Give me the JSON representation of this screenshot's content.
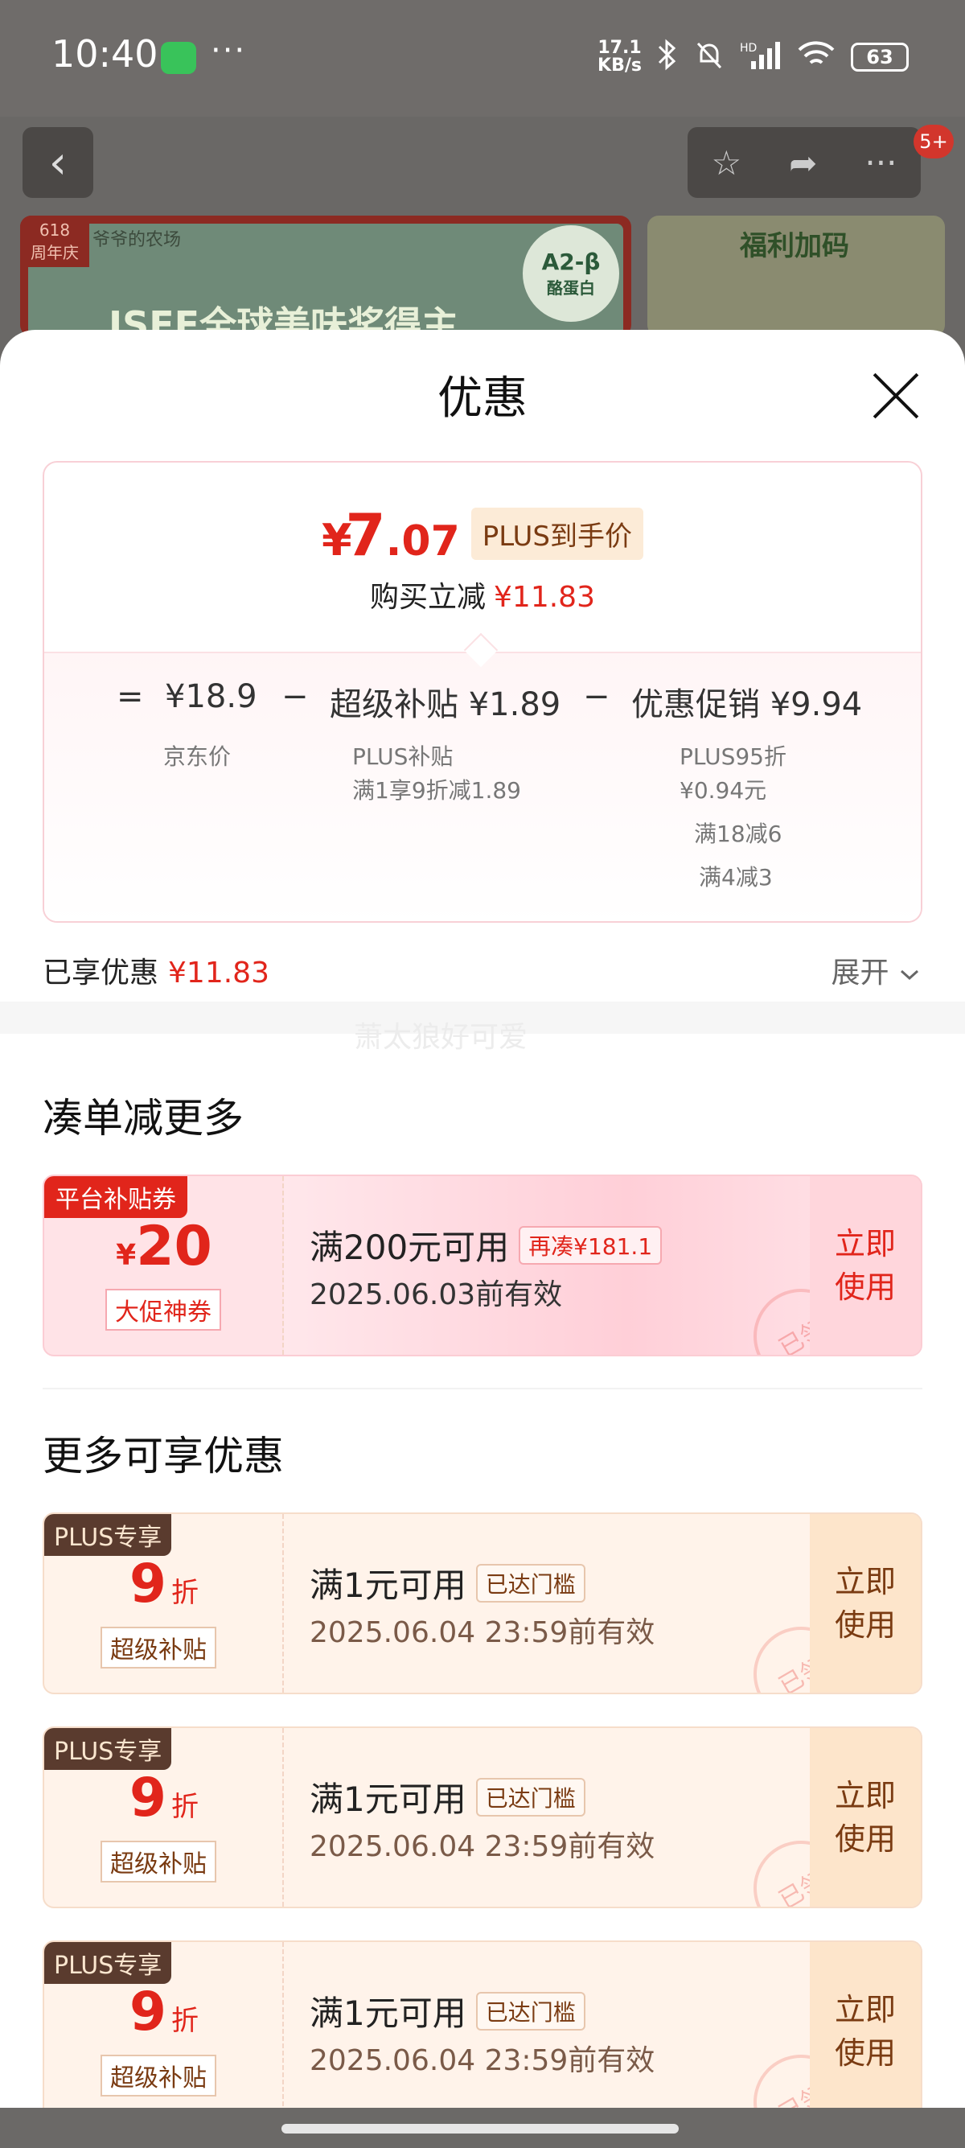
{
  "status_bar": {
    "time": "10:40",
    "dots": "···",
    "net_speed_value": "17.1",
    "net_speed_unit": "KB/s",
    "signal_label": "HD",
    "battery": "63"
  },
  "product_header": {
    "badge": "5+",
    "banner": {
      "tag_top": "618",
      "tag_bottom": "周年庆",
      "brand": "爷爷的农场",
      "slogan": "ISEE全球美味奖得主",
      "seal_title": "A2-β",
      "seal_sub": "酪蛋白"
    },
    "promo_title": "福利加码"
  },
  "sheet": {
    "title": "优惠",
    "price": {
      "currency": "¥",
      "integer": "7",
      "decimal": ".07",
      "plus_label": "PLUS到手价",
      "discount_label": "购买立减",
      "discount_value": "¥11.83",
      "formula": {
        "eq": "=",
        "jd_price": "¥18.9",
        "minus1": "−",
        "subsidy": "超级补贴 ¥1.89",
        "minus2": "−",
        "promo": "优惠促销 ¥9.94",
        "jd_price_label": "京东价",
        "subsidy_lines": [
          "PLUS补贴",
          "满1享9折减1.89"
        ],
        "promo_lines": [
          "PLUS95折",
          "¥0.94元",
          "满18减6",
          "满4减3"
        ]
      }
    },
    "enjoyed_label": "已享优惠",
    "enjoyed_value": "¥11.83",
    "expand_label": "展开",
    "watermark": "萧太狼好可爱",
    "section1_title": "凑单减更多",
    "platform_coupon": {
      "tag": "平台补贴券",
      "currency": "¥",
      "amount": "20",
      "caption": "大促神券",
      "condition": "满200元可用",
      "chip": "再凑¥181.1",
      "date": "2025.06.03前有效",
      "action_lines": [
        "立即",
        "使用"
      ],
      "stamp": "已领"
    },
    "section2_title": "更多可享优惠",
    "plus_coupons": [
      {
        "tag": "PLUS专享",
        "amount": "9",
        "unit": "折",
        "caption": "超级补贴",
        "condition": "满1元可用",
        "chip": "已达门槛",
        "date": "2025.06.04 23:59前有效",
        "action_lines": [
          "立即",
          "使用"
        ],
        "stamp": "已领"
      },
      {
        "tag": "PLUS专享",
        "amount": "9",
        "unit": "折",
        "caption": "超级补贴",
        "condition": "满1元可用",
        "chip": "已达门槛",
        "date": "2025.06.04 23:59前有效",
        "action_lines": [
          "立即",
          "使用"
        ],
        "stamp": "已领"
      },
      {
        "tag": "PLUS专享",
        "amount": "9",
        "unit": "折",
        "caption": "超级补贴",
        "condition": "满1元可用",
        "chip": "已达门槛",
        "date": "2025.06.04 23:59前有效",
        "action_lines": [
          "立即",
          "使用"
        ],
        "stamp": "已领"
      }
    ]
  },
  "colors": {
    "accent_red": "#e1251b",
    "plus_brown": "#5a3b2e",
    "plus_gold": "#fde5cb"
  }
}
